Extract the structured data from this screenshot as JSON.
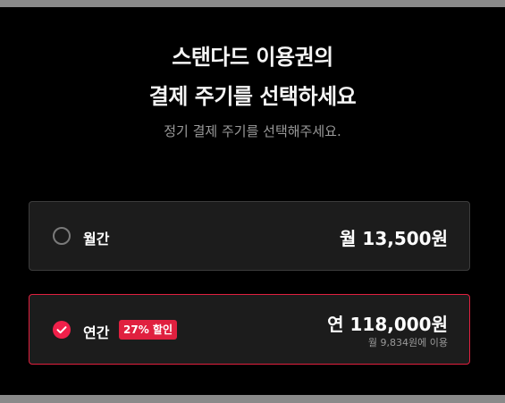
{
  "header": {
    "title_line1": "스탠다드 이용권의",
    "title_line2": "결제 주기를 선택하세요",
    "subtitle": "정기 결제 주기를 선택해주세요."
  },
  "plans": [
    {
      "name": "월간",
      "price": "월 13,500원",
      "selected": false
    },
    {
      "name": "연간",
      "badge": "27% 할인",
      "price": "연 118,000원",
      "price_note": "월 9,834원에 이용",
      "selected": true
    }
  ],
  "colors": {
    "accent": "#e0203f",
    "card_bg": "#1c1c1c",
    "background": "#000000"
  }
}
